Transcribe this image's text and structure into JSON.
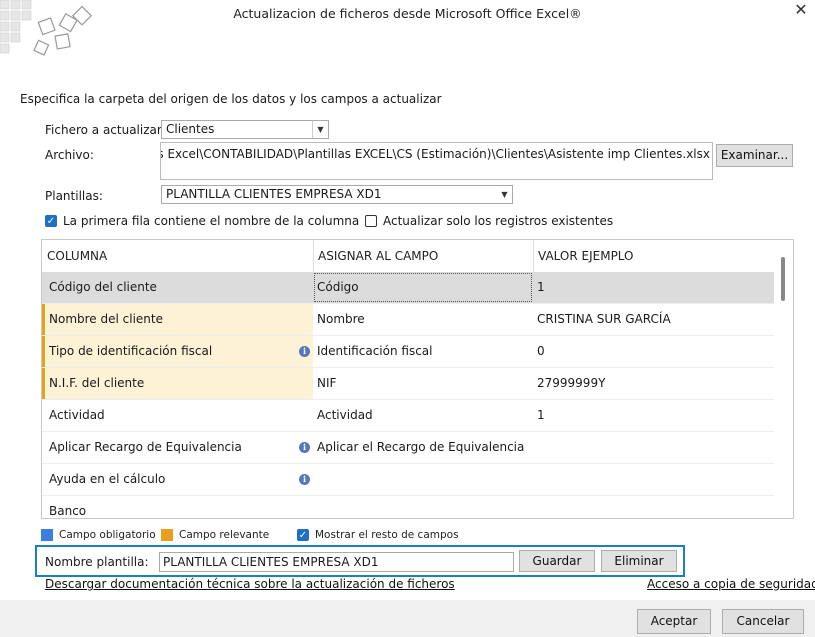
{
  "window": {
    "title": "Actualizacion de ficheros desde Microsoft Office Excel®",
    "close_glyph": "✕"
  },
  "form": {
    "instruction": "Especifica la carpeta del origen de los datos y los campos a actualizar",
    "fichero_label": "Fichero a actualizar:",
    "fichero_value": "Clientes",
    "archivo_label": "Archivo:",
    "archivo_value": "à Privada\\Plantillas Excel\\CONTABILIDAD\\Plantillas EXCEL\\CS (Estimación)\\Clientes\\Asistente imp Clientes.xlsx",
    "examinar_label": "Examinar...",
    "plantillas_label": "Plantillas:",
    "plantillas_value": "PLANTILLA CLIENTES EMPRESA XD1",
    "primera_fila_label": "La primera fila contiene el nombre de la columna",
    "primera_fila_checked": true,
    "solo_existentes_label": "Actualizar solo los registros existentes",
    "solo_existentes_checked": false
  },
  "grid": {
    "headers": [
      "COLUMNA",
      "ASIGNAR AL CAMPO",
      "VALOR EJEMPLO"
    ],
    "rows": [
      {
        "columna": "Código del cliente",
        "campo": "Código",
        "valor": "1",
        "selected": true,
        "mandatory": false,
        "info": false
      },
      {
        "columna": "Nombre del cliente",
        "campo": "Nombre",
        "valor": "CRISTINA SUR GARCÍA",
        "selected": false,
        "mandatory": true,
        "info": false
      },
      {
        "columna": "Tipo de identificación fiscal",
        "campo": "Identificación fiscal",
        "valor": "0",
        "selected": false,
        "mandatory": true,
        "info": true
      },
      {
        "columna": "N.I.F. del cliente",
        "campo": "NIF",
        "valor": "27999999Y",
        "selected": false,
        "mandatory": true,
        "info": false
      },
      {
        "columna": "Actividad",
        "campo": "Actividad",
        "valor": "1",
        "selected": false,
        "mandatory": false,
        "info": false
      },
      {
        "columna": "Aplicar Recargo de Equivalencia",
        "campo": "Aplicar el Recargo de Equivalencia",
        "valor": "",
        "selected": false,
        "mandatory": false,
        "info": true
      },
      {
        "columna": "Ayuda en el cálculo",
        "campo": "",
        "valor": "",
        "selected": false,
        "mandatory": false,
        "info": true
      },
      {
        "columna": "Banco",
        "campo": "",
        "valor": "",
        "selected": false,
        "mandatory": false,
        "info": false
      }
    ]
  },
  "legend": {
    "obligatorio_label": "Campo obligatorio",
    "obligatorio_color": "#3c7fe0",
    "relevante_label": "Campo relevante",
    "relevante_color": "#e8a11f",
    "mostrar_label": "Mostrar el resto de campos",
    "mostrar_checked": true
  },
  "template": {
    "label": "Nombre plantilla:",
    "value": "PLANTILLA CLIENTES EMPRESA XD1",
    "guardar_label": "Guardar",
    "eliminar_label": "Eliminar"
  },
  "links": {
    "doc": "Descargar documentación técnica sobre la actualización de ficheros",
    "backup": "Acceso a copia de seguridad"
  },
  "footer": {
    "accept_label": "Aceptar",
    "cancel_label": "Cancelar"
  }
}
